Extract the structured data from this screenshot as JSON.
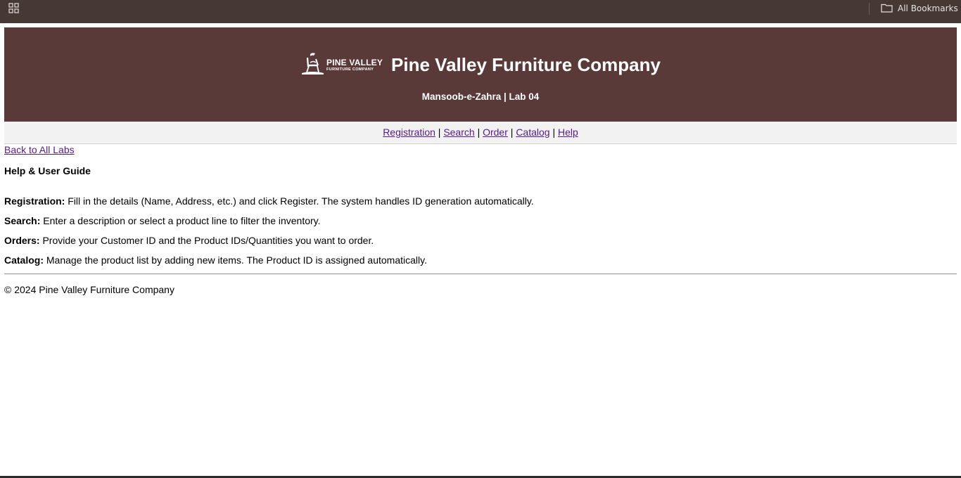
{
  "browser": {
    "bookmarks_label": "All Bookmarks"
  },
  "header": {
    "logo_line1": "PINE VALLEY",
    "logo_line2": "FURNITURE COMPANY",
    "title": "Pine Valley Furniture Company",
    "subtitle": "Mansoob-e-Zahra | Lab 04",
    "background_color": "#5a3939"
  },
  "nav": {
    "links": [
      "Registration",
      "Search",
      "Order",
      "Catalog",
      "Help"
    ],
    "separator": "|",
    "link_color": "#551a8b"
  },
  "back_link": "Back to All Labs",
  "guide": {
    "title": "Help & User Guide",
    "items": [
      {
        "term": "Registration:",
        "text": " Fill in the details (Name, Address, etc.) and click Register. The system handles ID generation automatically."
      },
      {
        "term": "Search:",
        "text": " Enter a description or select a product line to filter the inventory."
      },
      {
        "term": "Orders:",
        "text": " Provide your Customer ID and the Product IDs/Quantities you want to order."
      },
      {
        "term": "Catalog:",
        "text": " Manage the product list by adding new items. The Product ID is assigned automatically."
      }
    ]
  },
  "footer": "© 2024 Pine Valley Furniture Company",
  "icons": {
    "apps": "apps-grid-icon",
    "folder": "folder-icon",
    "logo": "chair-logo-icon"
  }
}
